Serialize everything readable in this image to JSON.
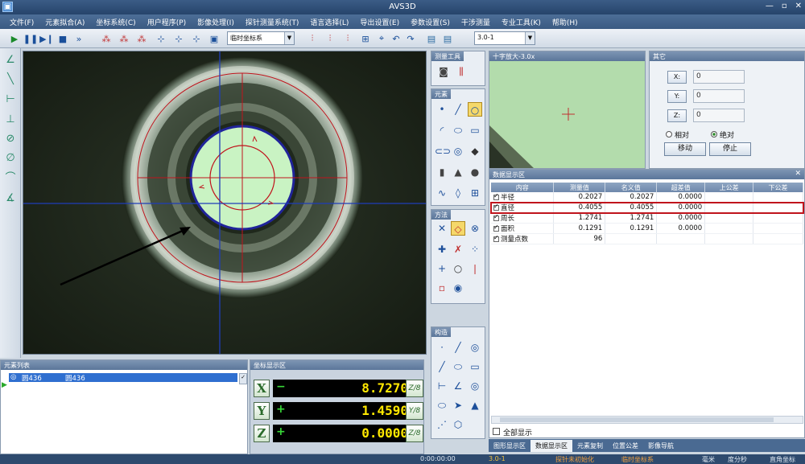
{
  "window": {
    "title": "AVS3D",
    "controls": [
      "—",
      "▫",
      "✕"
    ]
  },
  "menu": [
    "文件(F)",
    "元素拟合(A)",
    "坐标系统(C)",
    "用户程序(P)",
    "影像处理(I)",
    "探针测量系统(T)",
    "语言选择(L)",
    "导出设置(E)",
    "参数设置(S)",
    "干涉测量",
    "专业工具(K)",
    "帮助(H)"
  ],
  "toolbar": {
    "coord_combo": "临时坐标系",
    "zoom_combo": "3.0-1",
    "icons": [
      "play-icon",
      "pause-icon",
      "step-icon",
      "stop-icon",
      "fast-forward-icon",
      "point-coord-icon",
      "point-coord2-icon",
      "point-coord3-icon",
      "axes-icon",
      "axes2-icon",
      "axes3-icon",
      "save-icon",
      "align-icon",
      "align2-icon",
      "align3-icon",
      "align4-icon",
      "probe-icon",
      "undo-icon",
      "redo-icon",
      "image-icon"
    ]
  },
  "left_tools": [
    "angle-icon",
    "line-icon",
    "width-icon",
    "height-icon",
    "diameter-icon",
    "arc-icon",
    "angle2-icon"
  ],
  "palettes": {
    "measure_tools": {
      "title": "测量工具"
    },
    "elements": {
      "title": "元素"
    },
    "methods": {
      "title": "方法"
    },
    "construct": {
      "title": "构造"
    }
  },
  "zoom_view": {
    "title": "十字放大-3.0x"
  },
  "other": {
    "title": "其它",
    "x_label": "X:",
    "x_value": "0",
    "y_label": "Y:",
    "y_value": "0",
    "z_label": "Z:",
    "z_value": "0",
    "relative_label": "相对",
    "absolute_label": "绝对",
    "move_button": "移动",
    "stop_button": "停止"
  },
  "data_panel": {
    "title": "数据显示区",
    "columns": [
      "内容",
      "测量值",
      "名义值",
      "超差值",
      "上公差",
      "下公差"
    ],
    "rows": [
      {
        "name": "半径",
        "measured": "0.2027",
        "nominal": "0.2027",
        "diff": "0.0000"
      },
      {
        "name": "直径",
        "measured": "0.4055",
        "nominal": "0.4055",
        "diff": "0.0000"
      },
      {
        "name": "周长",
        "measured": "1.2741",
        "nominal": "1.2741",
        "diff": "0.0000"
      },
      {
        "name": "面积",
        "measured": "0.1291",
        "nominal": "0.1291",
        "diff": "0.0000"
      },
      {
        "name": "测量点数",
        "measured": "96",
        "nominal": "",
        "diff": ""
      }
    ],
    "show_all_label": "全部显示"
  },
  "bottom_tabs": [
    "图形显示区",
    "数据显示区",
    "元素复制",
    "位置公差",
    "影像导航"
  ],
  "element_list": {
    "title": "元素列表",
    "row_id": "圆436",
    "row_name": "圆436"
  },
  "coord_display": {
    "title": "坐标显示区",
    "x": {
      "label": "X",
      "sign": "−",
      "value": "8.7270",
      "mode": "Z/8"
    },
    "y": {
      "label": "Y",
      "sign": "+",
      "value": "1.4590",
      "mode": "Y/8"
    },
    "z": {
      "label": "Z",
      "sign": "+",
      "value": "0.0000",
      "mode": "Z/8"
    }
  },
  "status_bar": {
    "time": "0:00:00:00",
    "zoom": "3.0-1",
    "probe_status": "探针未初始化",
    "coord_system": "临时坐标系",
    "unit": "毫米",
    "angle_unit": "度分秒",
    "coord_type": "直角坐标"
  },
  "colors": {
    "accent": "#2e4a6e",
    "highlight_row_border": "#c0141c",
    "readout": "#ffe800"
  }
}
